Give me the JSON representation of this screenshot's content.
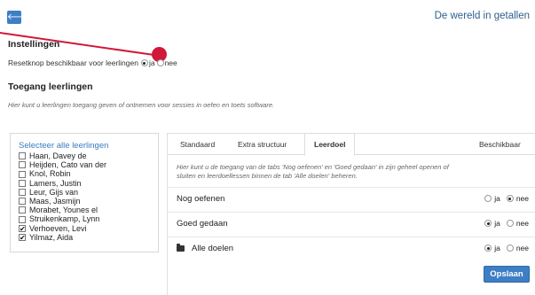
{
  "header": {
    "back_label": "🡐",
    "app_title": "De wereld in getallen"
  },
  "settings": {
    "title": "Instellingen",
    "reset_label": "Resetknop beschikbaar voor leerlingen",
    "reset_options": {
      "yes": "ja",
      "no": "nee",
      "selected": "ja"
    }
  },
  "access": {
    "title": "Toegang leerlingen",
    "description": "Hier kunt u leerlingen toegang geven of ontnemen voor sessies in oefen en toets software."
  },
  "students": {
    "select_all": "Selecteer alle leerlingen",
    "items": [
      {
        "name": "Haan, Davey de",
        "checked": false
      },
      {
        "name": "Heijden, Cato van der",
        "checked": false
      },
      {
        "name": "Knol, Robin",
        "checked": false
      },
      {
        "name": "Lamers, Justin",
        "checked": false
      },
      {
        "name": "Leur, Gijs van",
        "checked": false
      },
      {
        "name": "Maas, Jasmijn",
        "checked": false
      },
      {
        "name": "Morabet, Younes el",
        "checked": false
      },
      {
        "name": "Struikenkamp, Lynn",
        "checked": false
      },
      {
        "name": "Verhoeven, Levi",
        "checked": true
      },
      {
        "name": "Yilmaz, Aida",
        "checked": true
      }
    ]
  },
  "panel": {
    "tabs": [
      {
        "label": "Standaard",
        "active": false
      },
      {
        "label": "Extra structuur",
        "active": false
      },
      {
        "label": "Leerdoel",
        "active": true
      },
      {
        "label": "Beschikbaar",
        "active": false
      }
    ],
    "description": "Hier kunt u de toegang van de tabs 'Nog oefenen' en 'Goed gedaan' in zijn geheel openen of sluiten en leerdoellessen binnen de tab 'Alle doelen' beheren.",
    "rows": [
      {
        "label": "Nog oefenen",
        "yes": "ja",
        "no": "nee",
        "selected": "nee"
      },
      {
        "label": "Goed gedaan",
        "yes": "ja",
        "no": "nee",
        "selected": "ja"
      },
      {
        "label": "Alle doelen",
        "yes": "ja",
        "no": "nee",
        "selected": "ja",
        "icon": "folder-icon"
      }
    ],
    "save_label": "Opslaan"
  },
  "colors": {
    "accent": "#3d7ec4",
    "link": "#3a7cc0",
    "highlight": "#d01839"
  }
}
